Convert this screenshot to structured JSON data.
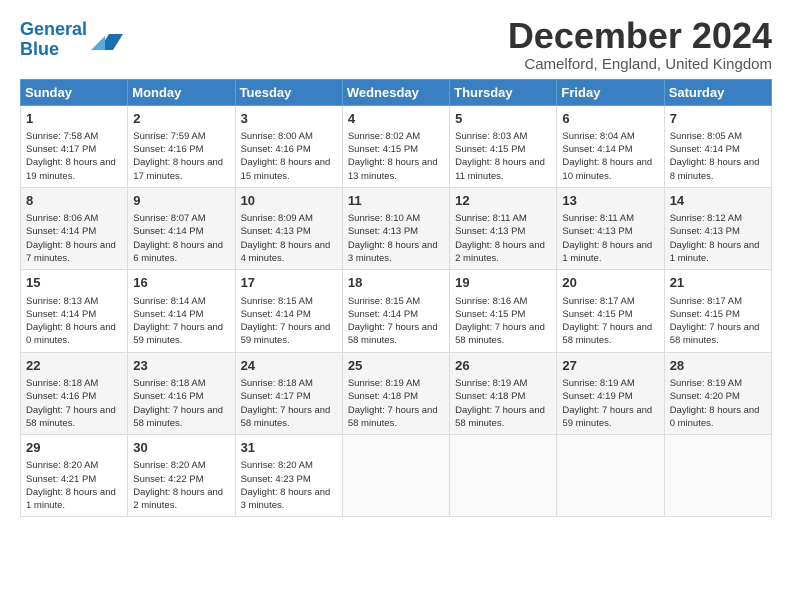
{
  "logo": {
    "line1": "General",
    "line2": "Blue"
  },
  "title": "December 2024",
  "location": "Camelford, England, United Kingdom",
  "days_of_week": [
    "Sunday",
    "Monday",
    "Tuesday",
    "Wednesday",
    "Thursday",
    "Friday",
    "Saturday"
  ],
  "weeks": [
    [
      {
        "day": "1",
        "sunrise": "Sunrise: 7:58 AM",
        "sunset": "Sunset: 4:17 PM",
        "daylight": "Daylight: 8 hours and 19 minutes."
      },
      {
        "day": "2",
        "sunrise": "Sunrise: 7:59 AM",
        "sunset": "Sunset: 4:16 PM",
        "daylight": "Daylight: 8 hours and 17 minutes."
      },
      {
        "day": "3",
        "sunrise": "Sunrise: 8:00 AM",
        "sunset": "Sunset: 4:16 PM",
        "daylight": "Daylight: 8 hours and 15 minutes."
      },
      {
        "day": "4",
        "sunrise": "Sunrise: 8:02 AM",
        "sunset": "Sunset: 4:15 PM",
        "daylight": "Daylight: 8 hours and 13 minutes."
      },
      {
        "day": "5",
        "sunrise": "Sunrise: 8:03 AM",
        "sunset": "Sunset: 4:15 PM",
        "daylight": "Daylight: 8 hours and 11 minutes."
      },
      {
        "day": "6",
        "sunrise": "Sunrise: 8:04 AM",
        "sunset": "Sunset: 4:14 PM",
        "daylight": "Daylight: 8 hours and 10 minutes."
      },
      {
        "day": "7",
        "sunrise": "Sunrise: 8:05 AM",
        "sunset": "Sunset: 4:14 PM",
        "daylight": "Daylight: 8 hours and 8 minutes."
      }
    ],
    [
      {
        "day": "8",
        "sunrise": "Sunrise: 8:06 AM",
        "sunset": "Sunset: 4:14 PM",
        "daylight": "Daylight: 8 hours and 7 minutes."
      },
      {
        "day": "9",
        "sunrise": "Sunrise: 8:07 AM",
        "sunset": "Sunset: 4:14 PM",
        "daylight": "Daylight: 8 hours and 6 minutes."
      },
      {
        "day": "10",
        "sunrise": "Sunrise: 8:09 AM",
        "sunset": "Sunset: 4:13 PM",
        "daylight": "Daylight: 8 hours and 4 minutes."
      },
      {
        "day": "11",
        "sunrise": "Sunrise: 8:10 AM",
        "sunset": "Sunset: 4:13 PM",
        "daylight": "Daylight: 8 hours and 3 minutes."
      },
      {
        "day": "12",
        "sunrise": "Sunrise: 8:11 AM",
        "sunset": "Sunset: 4:13 PM",
        "daylight": "Daylight: 8 hours and 2 minutes."
      },
      {
        "day": "13",
        "sunrise": "Sunrise: 8:11 AM",
        "sunset": "Sunset: 4:13 PM",
        "daylight": "Daylight: 8 hours and 1 minute."
      },
      {
        "day": "14",
        "sunrise": "Sunrise: 8:12 AM",
        "sunset": "Sunset: 4:13 PM",
        "daylight": "Daylight: 8 hours and 1 minute."
      }
    ],
    [
      {
        "day": "15",
        "sunrise": "Sunrise: 8:13 AM",
        "sunset": "Sunset: 4:14 PM",
        "daylight": "Daylight: 8 hours and 0 minutes."
      },
      {
        "day": "16",
        "sunrise": "Sunrise: 8:14 AM",
        "sunset": "Sunset: 4:14 PM",
        "daylight": "Daylight: 7 hours and 59 minutes."
      },
      {
        "day": "17",
        "sunrise": "Sunrise: 8:15 AM",
        "sunset": "Sunset: 4:14 PM",
        "daylight": "Daylight: 7 hours and 59 minutes."
      },
      {
        "day": "18",
        "sunrise": "Sunrise: 8:15 AM",
        "sunset": "Sunset: 4:14 PM",
        "daylight": "Daylight: 7 hours and 58 minutes."
      },
      {
        "day": "19",
        "sunrise": "Sunrise: 8:16 AM",
        "sunset": "Sunset: 4:15 PM",
        "daylight": "Daylight: 7 hours and 58 minutes."
      },
      {
        "day": "20",
        "sunrise": "Sunrise: 8:17 AM",
        "sunset": "Sunset: 4:15 PM",
        "daylight": "Daylight: 7 hours and 58 minutes."
      },
      {
        "day": "21",
        "sunrise": "Sunrise: 8:17 AM",
        "sunset": "Sunset: 4:15 PM",
        "daylight": "Daylight: 7 hours and 58 minutes."
      }
    ],
    [
      {
        "day": "22",
        "sunrise": "Sunrise: 8:18 AM",
        "sunset": "Sunset: 4:16 PM",
        "daylight": "Daylight: 7 hours and 58 minutes."
      },
      {
        "day": "23",
        "sunrise": "Sunrise: 8:18 AM",
        "sunset": "Sunset: 4:16 PM",
        "daylight": "Daylight: 7 hours and 58 minutes."
      },
      {
        "day": "24",
        "sunrise": "Sunrise: 8:18 AM",
        "sunset": "Sunset: 4:17 PM",
        "daylight": "Daylight: 7 hours and 58 minutes."
      },
      {
        "day": "25",
        "sunrise": "Sunrise: 8:19 AM",
        "sunset": "Sunset: 4:18 PM",
        "daylight": "Daylight: 7 hours and 58 minutes."
      },
      {
        "day": "26",
        "sunrise": "Sunrise: 8:19 AM",
        "sunset": "Sunset: 4:18 PM",
        "daylight": "Daylight: 7 hours and 58 minutes."
      },
      {
        "day": "27",
        "sunrise": "Sunrise: 8:19 AM",
        "sunset": "Sunset: 4:19 PM",
        "daylight": "Daylight: 7 hours and 59 minutes."
      },
      {
        "day": "28",
        "sunrise": "Sunrise: 8:19 AM",
        "sunset": "Sunset: 4:20 PM",
        "daylight": "Daylight: 8 hours and 0 minutes."
      }
    ],
    [
      {
        "day": "29",
        "sunrise": "Sunrise: 8:20 AM",
        "sunset": "Sunset: 4:21 PM",
        "daylight": "Daylight: 8 hours and 1 minute."
      },
      {
        "day": "30",
        "sunrise": "Sunrise: 8:20 AM",
        "sunset": "Sunset: 4:22 PM",
        "daylight": "Daylight: 8 hours and 2 minutes."
      },
      {
        "day": "31",
        "sunrise": "Sunrise: 8:20 AM",
        "sunset": "Sunset: 4:23 PM",
        "daylight": "Daylight: 8 hours and 3 minutes."
      },
      null,
      null,
      null,
      null
    ]
  ]
}
